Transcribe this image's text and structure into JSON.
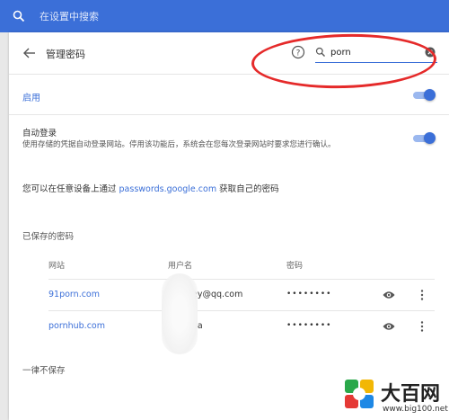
{
  "settings_search": {
    "placeholder": "在设置中搜索"
  },
  "header": {
    "title": "管理密码"
  },
  "password_search": {
    "value": "porn"
  },
  "enable": {
    "label": "启用",
    "on": true
  },
  "auto_signin": {
    "title": "自动登录",
    "description": "使用存储的凭据自动登录网站。停用该功能后，系统会在您每次登录网站时要求您进行确认。",
    "on": true
  },
  "remote_access": {
    "prefix": "您可以在任意设备上通过 ",
    "link": "passwords.google.com",
    "suffix": " 获取自己的密码"
  },
  "saved_passwords": {
    "heading": "已保存的密码",
    "columns": [
      "网站",
      "用户名",
      "密码"
    ],
    "rows": [
      {
        "site": "91porn.com",
        "username": "ney@qq.com",
        "password": "••••••••"
      },
      {
        "site": "pornhub.com",
        "username": "ona",
        "password": "••••••••"
      }
    ]
  },
  "never_saved": {
    "heading": "一律不保存"
  },
  "watermark": {
    "title": "大百网",
    "url": "www.big100.net"
  },
  "colors": {
    "accent": "#3b6fd8",
    "annotation": "#e52a2a"
  }
}
